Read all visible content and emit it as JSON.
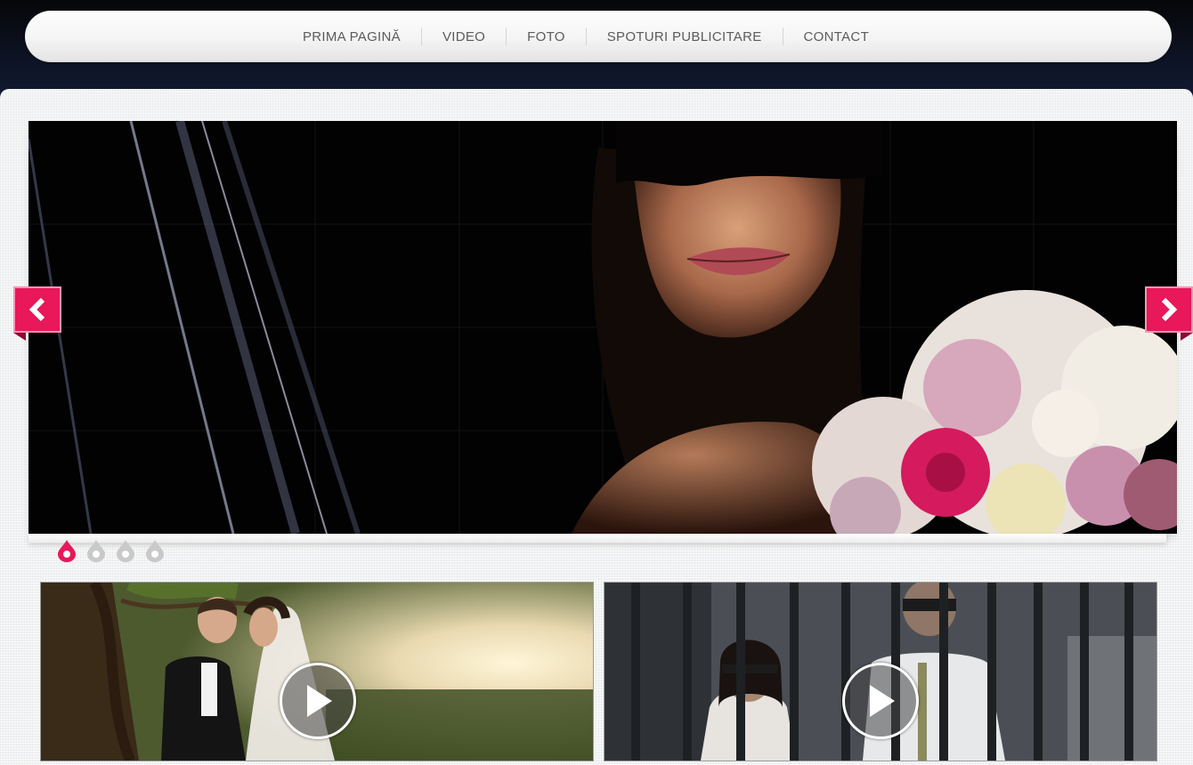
{
  "nav": {
    "items": [
      {
        "label": "PRIMA PAGINĂ"
      },
      {
        "label": "VIDEO"
      },
      {
        "label": "FOTO"
      },
      {
        "label": "SPOTURI PUBLICITARE"
      },
      {
        "label": "CONTACT"
      }
    ]
  },
  "slider": {
    "prev_icon": "chevron-left-icon",
    "next_icon": "chevron-right-icon",
    "bullets": [
      {
        "active": true
      },
      {
        "active": false
      },
      {
        "active": false
      },
      {
        "active": false
      }
    ],
    "accent_color": "#e8185a"
  },
  "videos": [
    {
      "play_icon": "play-icon"
    },
    {
      "play_icon": "play-icon"
    }
  ]
}
